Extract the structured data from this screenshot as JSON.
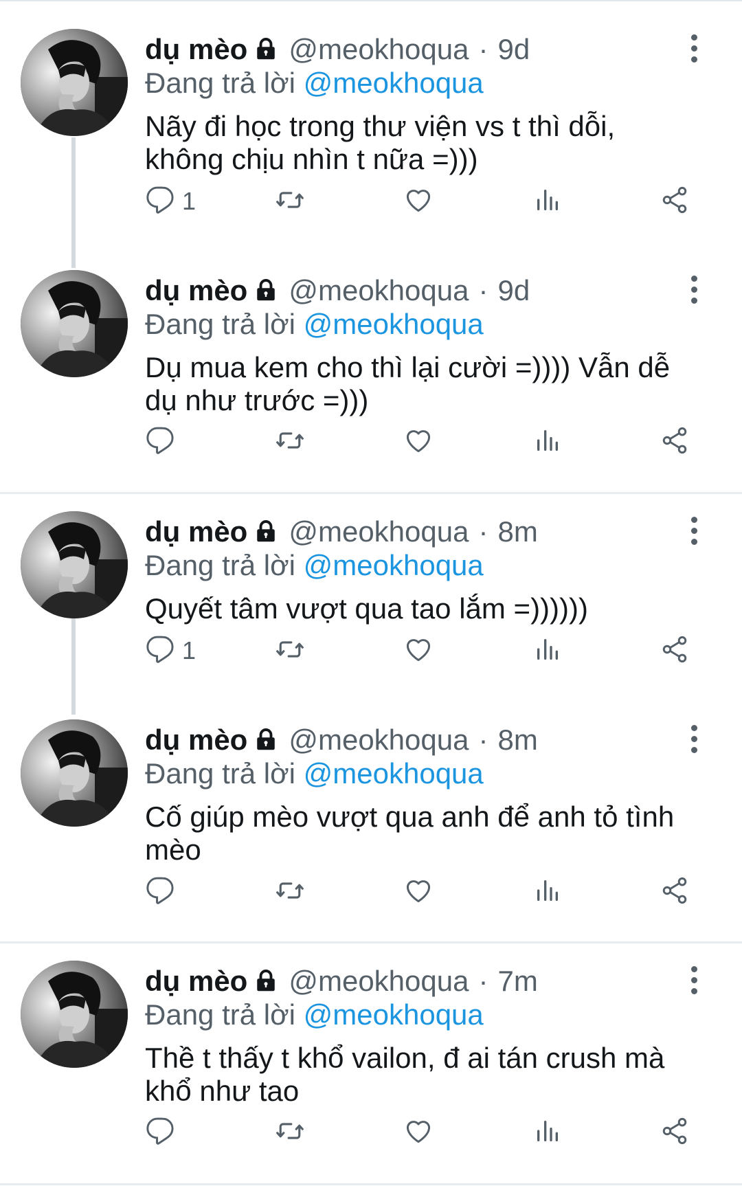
{
  "theme": {
    "accent": "#1b95e0",
    "secondary_text": "#555f68",
    "primary_text": "#14171a"
  },
  "tweets": [
    {
      "name": "dụ mèo",
      "handle": "@meokhoqua",
      "separator": "·",
      "time": "9d",
      "reply_prefix": "Đang trả lời",
      "reply_to": "@meokhoqua",
      "text": "Nãy đi học trong thư viện vs t thì dỗi,\nkhông chịu nhìn t nữa =)))",
      "reply_count": "1"
    },
    {
      "name": "dụ mèo",
      "handle": "@meokhoqua",
      "separator": "·",
      "time": "9d",
      "reply_prefix": "Đang trả lời",
      "reply_to": "@meokhoqua",
      "text": "Dụ mua kem cho thì lại cười =)))) Vẫn dễ\ndụ như trước =)))",
      "reply_count": ""
    },
    {
      "name": "dụ mèo",
      "handle": "@meokhoqua",
      "separator": "·",
      "time": "8m",
      "reply_prefix": "Đang trả lời",
      "reply_to": "@meokhoqua",
      "text": "Quyết tâm vượt qua tao lắm =))))))",
      "reply_count": "1"
    },
    {
      "name": "dụ mèo",
      "handle": "@meokhoqua",
      "separator": "·",
      "time": "8m",
      "reply_prefix": "Đang trả lời",
      "reply_to": "@meokhoqua",
      "text": "Cố giúp mèo vượt qua anh để anh tỏ tình\nmèo",
      "reply_count": ""
    },
    {
      "name": "dụ mèo",
      "handle": "@meokhoqua",
      "separator": "·",
      "time": "7m",
      "reply_prefix": "Đang trả lời",
      "reply_to": "@meokhoqua",
      "text": "Thề t thấy t khổ vailon, đ ai tán crush mà\nkhổ như tao",
      "reply_count": ""
    }
  ],
  "icons": {
    "reply": "reply-icon",
    "retweet": "retweet-icon",
    "like": "like-icon",
    "analytics": "analytics-icon",
    "share": "share-icon",
    "lock": "lock-icon",
    "more": "more-icon"
  }
}
